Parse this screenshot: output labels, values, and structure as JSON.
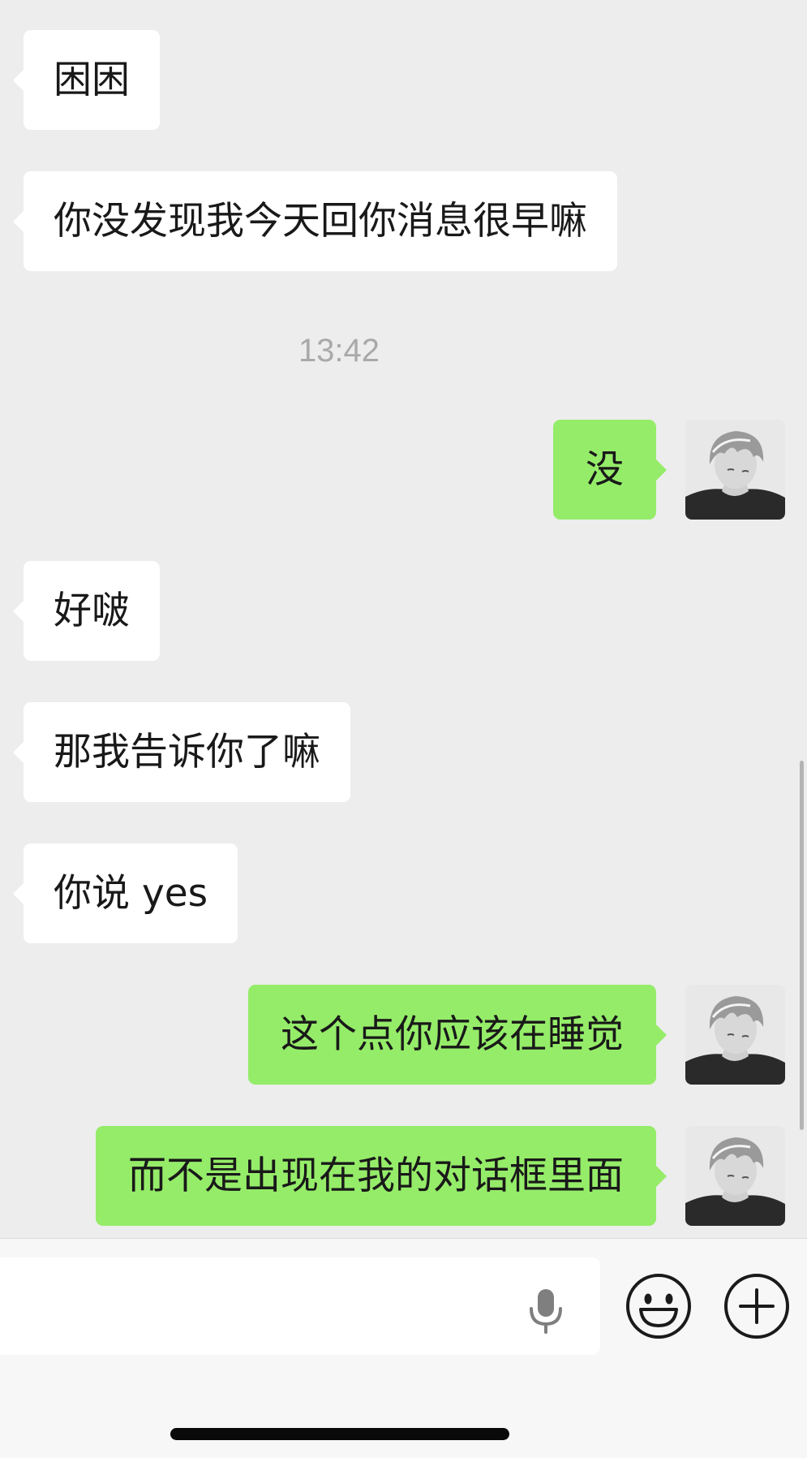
{
  "messages": [
    {
      "side": "in",
      "text": "困困"
    },
    {
      "side": "in",
      "text": "你没发现我今天回你消息很早嘛"
    },
    {
      "side": "out",
      "text": "没"
    },
    {
      "side": "in",
      "text": "好啵"
    },
    {
      "side": "in",
      "text": "那我告诉你了嘛"
    },
    {
      "side": "in",
      "text": "你说 yes"
    },
    {
      "side": "out",
      "text": "这个点你应该在睡觉"
    },
    {
      "side": "out",
      "text": "而不是出现在我的对话框里面"
    }
  ],
  "timestamp": "13:42",
  "colors": {
    "background": "#ededed",
    "incoming_bubble": "#ffffff",
    "outgoing_bubble": "#95ec69"
  },
  "icons": {
    "avatar": "avatar-icon",
    "mic": "microphone-icon",
    "emoji": "emoji-icon",
    "more": "plus-icon"
  }
}
